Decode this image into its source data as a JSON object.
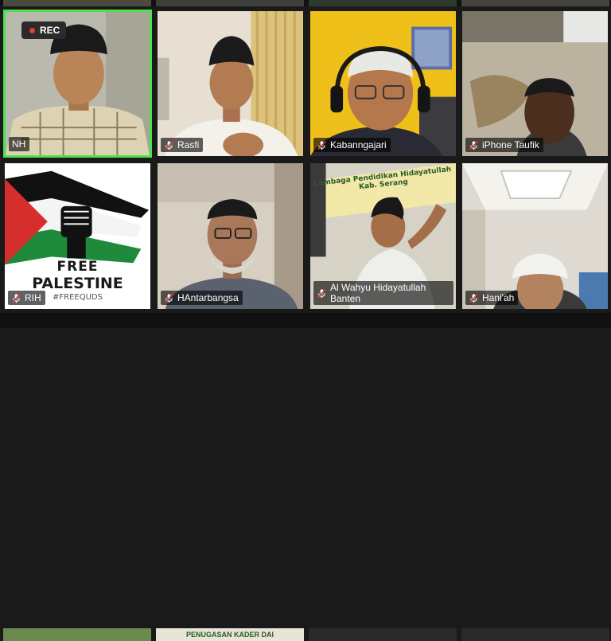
{
  "recording": {
    "label": "REC",
    "dot_color": "#e43a3a"
  },
  "active_border_color": "#4ce24c",
  "participants": [
    {
      "name": "NH",
      "muted": false,
      "active": true
    },
    {
      "name": "Rasfi",
      "muted": true
    },
    {
      "name": "Kabanngajari",
      "muted": true
    },
    {
      "name": "iPhone Taufik",
      "muted": true
    },
    {
      "name": "RIH",
      "muted": true,
      "poster": {
        "line1": "FREE",
        "line2": "PALESTINE",
        "line3": "#FREEQUDS"
      }
    },
    {
      "name": "HAntarbangsa",
      "muted": true
    },
    {
      "name": "Al Wahyu Hidayatullah Banten",
      "muted": true,
      "background_sign": "Lembaga Pendidikan Hidayatullah Kab. Serang"
    },
    {
      "name": "Hani'ah",
      "muted": true
    }
  ],
  "partial_bottom_row": {
    "sign_text": "PENUGASAN KADER DAI"
  },
  "icons": {
    "mic_muted": "mic-muted-icon",
    "record": "record-dot-icon"
  }
}
